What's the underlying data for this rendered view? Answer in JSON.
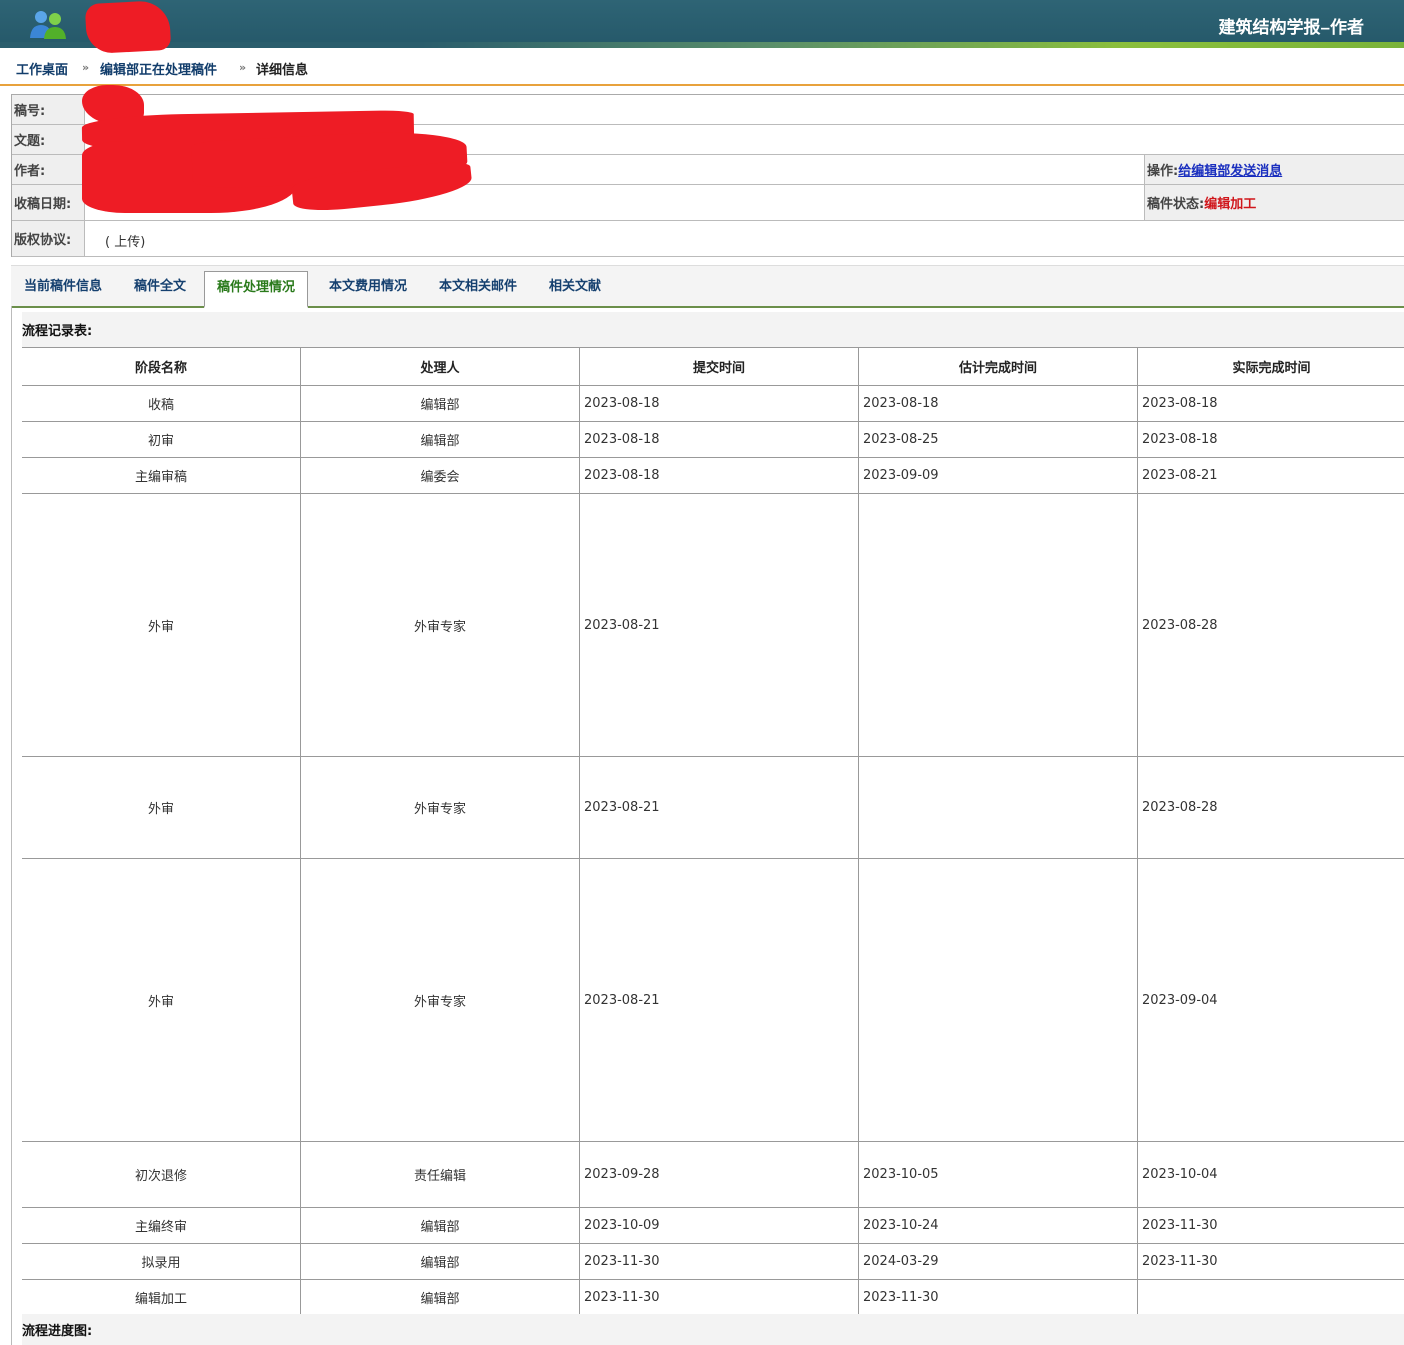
{
  "header": {
    "title": "建筑结构学报–作者",
    "logo_icon": "users-icon"
  },
  "breadcrumb": {
    "home": "工作桌面",
    "section": "编辑部正在处理稿件",
    "current": "详细信息",
    "separator": "»"
  },
  "info": {
    "manuscript_no_label": "稿号:",
    "title_label": "文题:",
    "author_label": "作者:",
    "received_label": "收稿日期:",
    "copyright_label": "版权协议:",
    "copyright_value": "( 上传)",
    "operation_label": "操作:",
    "operation_link": "给编辑部发送消息",
    "status_label": "稿件状态:",
    "status_value": "编辑加工"
  },
  "tabs": [
    {
      "label": "当前稿件信息"
    },
    {
      "label": "稿件全文"
    },
    {
      "label": "稿件处理情况",
      "active": true
    },
    {
      "label": "本文费用情况"
    },
    {
      "label": "本文相关邮件"
    },
    {
      "label": "相关文献"
    }
  ],
  "flow": {
    "title": "流程记录表:",
    "columns": [
      "阶段名称",
      "处理人",
      "提交时间",
      "估计完成时间",
      "实际完成时间"
    ],
    "rows": [
      {
        "stage": "收稿",
        "handler": "编辑部",
        "submitted": "2023-08-18",
        "estimated": "2023-08-18",
        "actual": "2023-08-18"
      },
      {
        "stage": "初审",
        "handler": "编辑部",
        "submitted": "2023-08-18",
        "estimated": "2023-08-25",
        "actual": "2023-08-18"
      },
      {
        "stage": "主编审稿",
        "handler": "编委会",
        "submitted": "2023-08-18",
        "estimated": "2023-09-09",
        "actual": "2023-08-21"
      },
      {
        "stage": "外审",
        "handler": "外审专家",
        "submitted": "2023-08-21",
        "estimated": "",
        "actual": "2023-08-28"
      },
      {
        "stage": "外审",
        "handler": "外审专家",
        "submitted": "2023-08-21",
        "estimated": "",
        "actual": "2023-08-28"
      },
      {
        "stage": "外审",
        "handler": "外审专家",
        "submitted": "2023-08-21",
        "estimated": "",
        "actual": "2023-09-04"
      },
      {
        "stage": "初次退修",
        "handler": "责任编辑",
        "submitted": "2023-09-28",
        "estimated": "2023-10-05",
        "actual": "2023-10-04"
      },
      {
        "stage": "主编终审",
        "handler": "编辑部",
        "submitted": "2023-10-09",
        "estimated": "2023-10-24",
        "actual": "2023-11-30"
      },
      {
        "stage": "拟录用",
        "handler": "编辑部",
        "submitted": "2023-11-30",
        "estimated": "2024-03-29",
        "actual": "2023-11-30"
      },
      {
        "stage": "编辑加工",
        "handler": "编辑部",
        "submitted": "2023-11-30",
        "estimated": "2023-11-30",
        "actual": ""
      }
    ]
  },
  "progress": {
    "title": "流程进度图:"
  },
  "colors": {
    "header": "#2a5d6c",
    "accent": "#e8a23c",
    "link": "#15406f",
    "status": "#d0161b",
    "active_tab": "#2a7a1b"
  }
}
